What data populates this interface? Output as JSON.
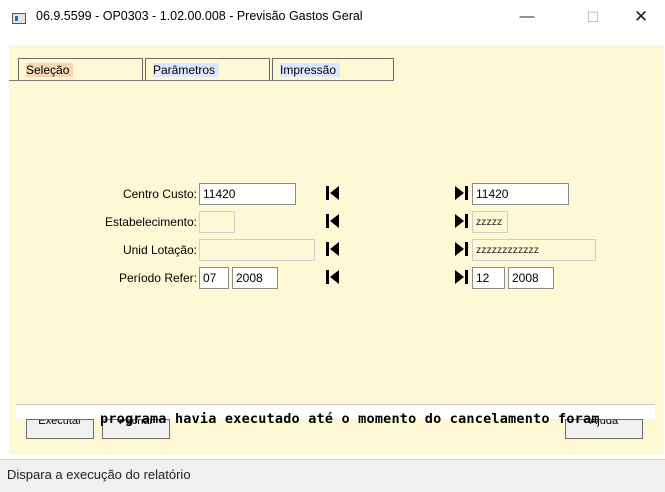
{
  "window": {
    "title": "06.9.5599 - OP0303 - 1.02.00.008 - Previsão Gastos Geral",
    "minimize": "—",
    "maximize": "☐",
    "close": "✕"
  },
  "tabs": [
    {
      "label": "Seleção",
      "active": true
    },
    {
      "label": "Parâmetros",
      "active": false
    },
    {
      "label": "Impressão",
      "active": false
    }
  ],
  "form": {
    "centro_custo": {
      "label": "Centro Custo:",
      "from": "11420",
      "to": "11420"
    },
    "estabelecimento": {
      "label": "Estabelecimento:",
      "from": "",
      "to": "zzzzz"
    },
    "unid_lotacao": {
      "label": "Unid Lotação:",
      "from": "",
      "to": "zzzzzzzzzzzz"
    },
    "periodo_refer": {
      "label": "Período Refer:",
      "from_month": "07",
      "from_year": "2008",
      "to_month": "12",
      "to_year": "2008"
    }
  },
  "buttons": {
    "executar": "Executar",
    "fechar": "Fechar",
    "ajuda": "Ajuda"
  },
  "overlay_message": "programa havia executado até o momento do cancelamento foram",
  "status_bar": "Dispara a execução do relatório",
  "colors": {
    "client_bg": "#fff8d5",
    "active_tab_highlight": "#f6d7b2",
    "inactive_tab_highlight": "#dde8ff"
  }
}
